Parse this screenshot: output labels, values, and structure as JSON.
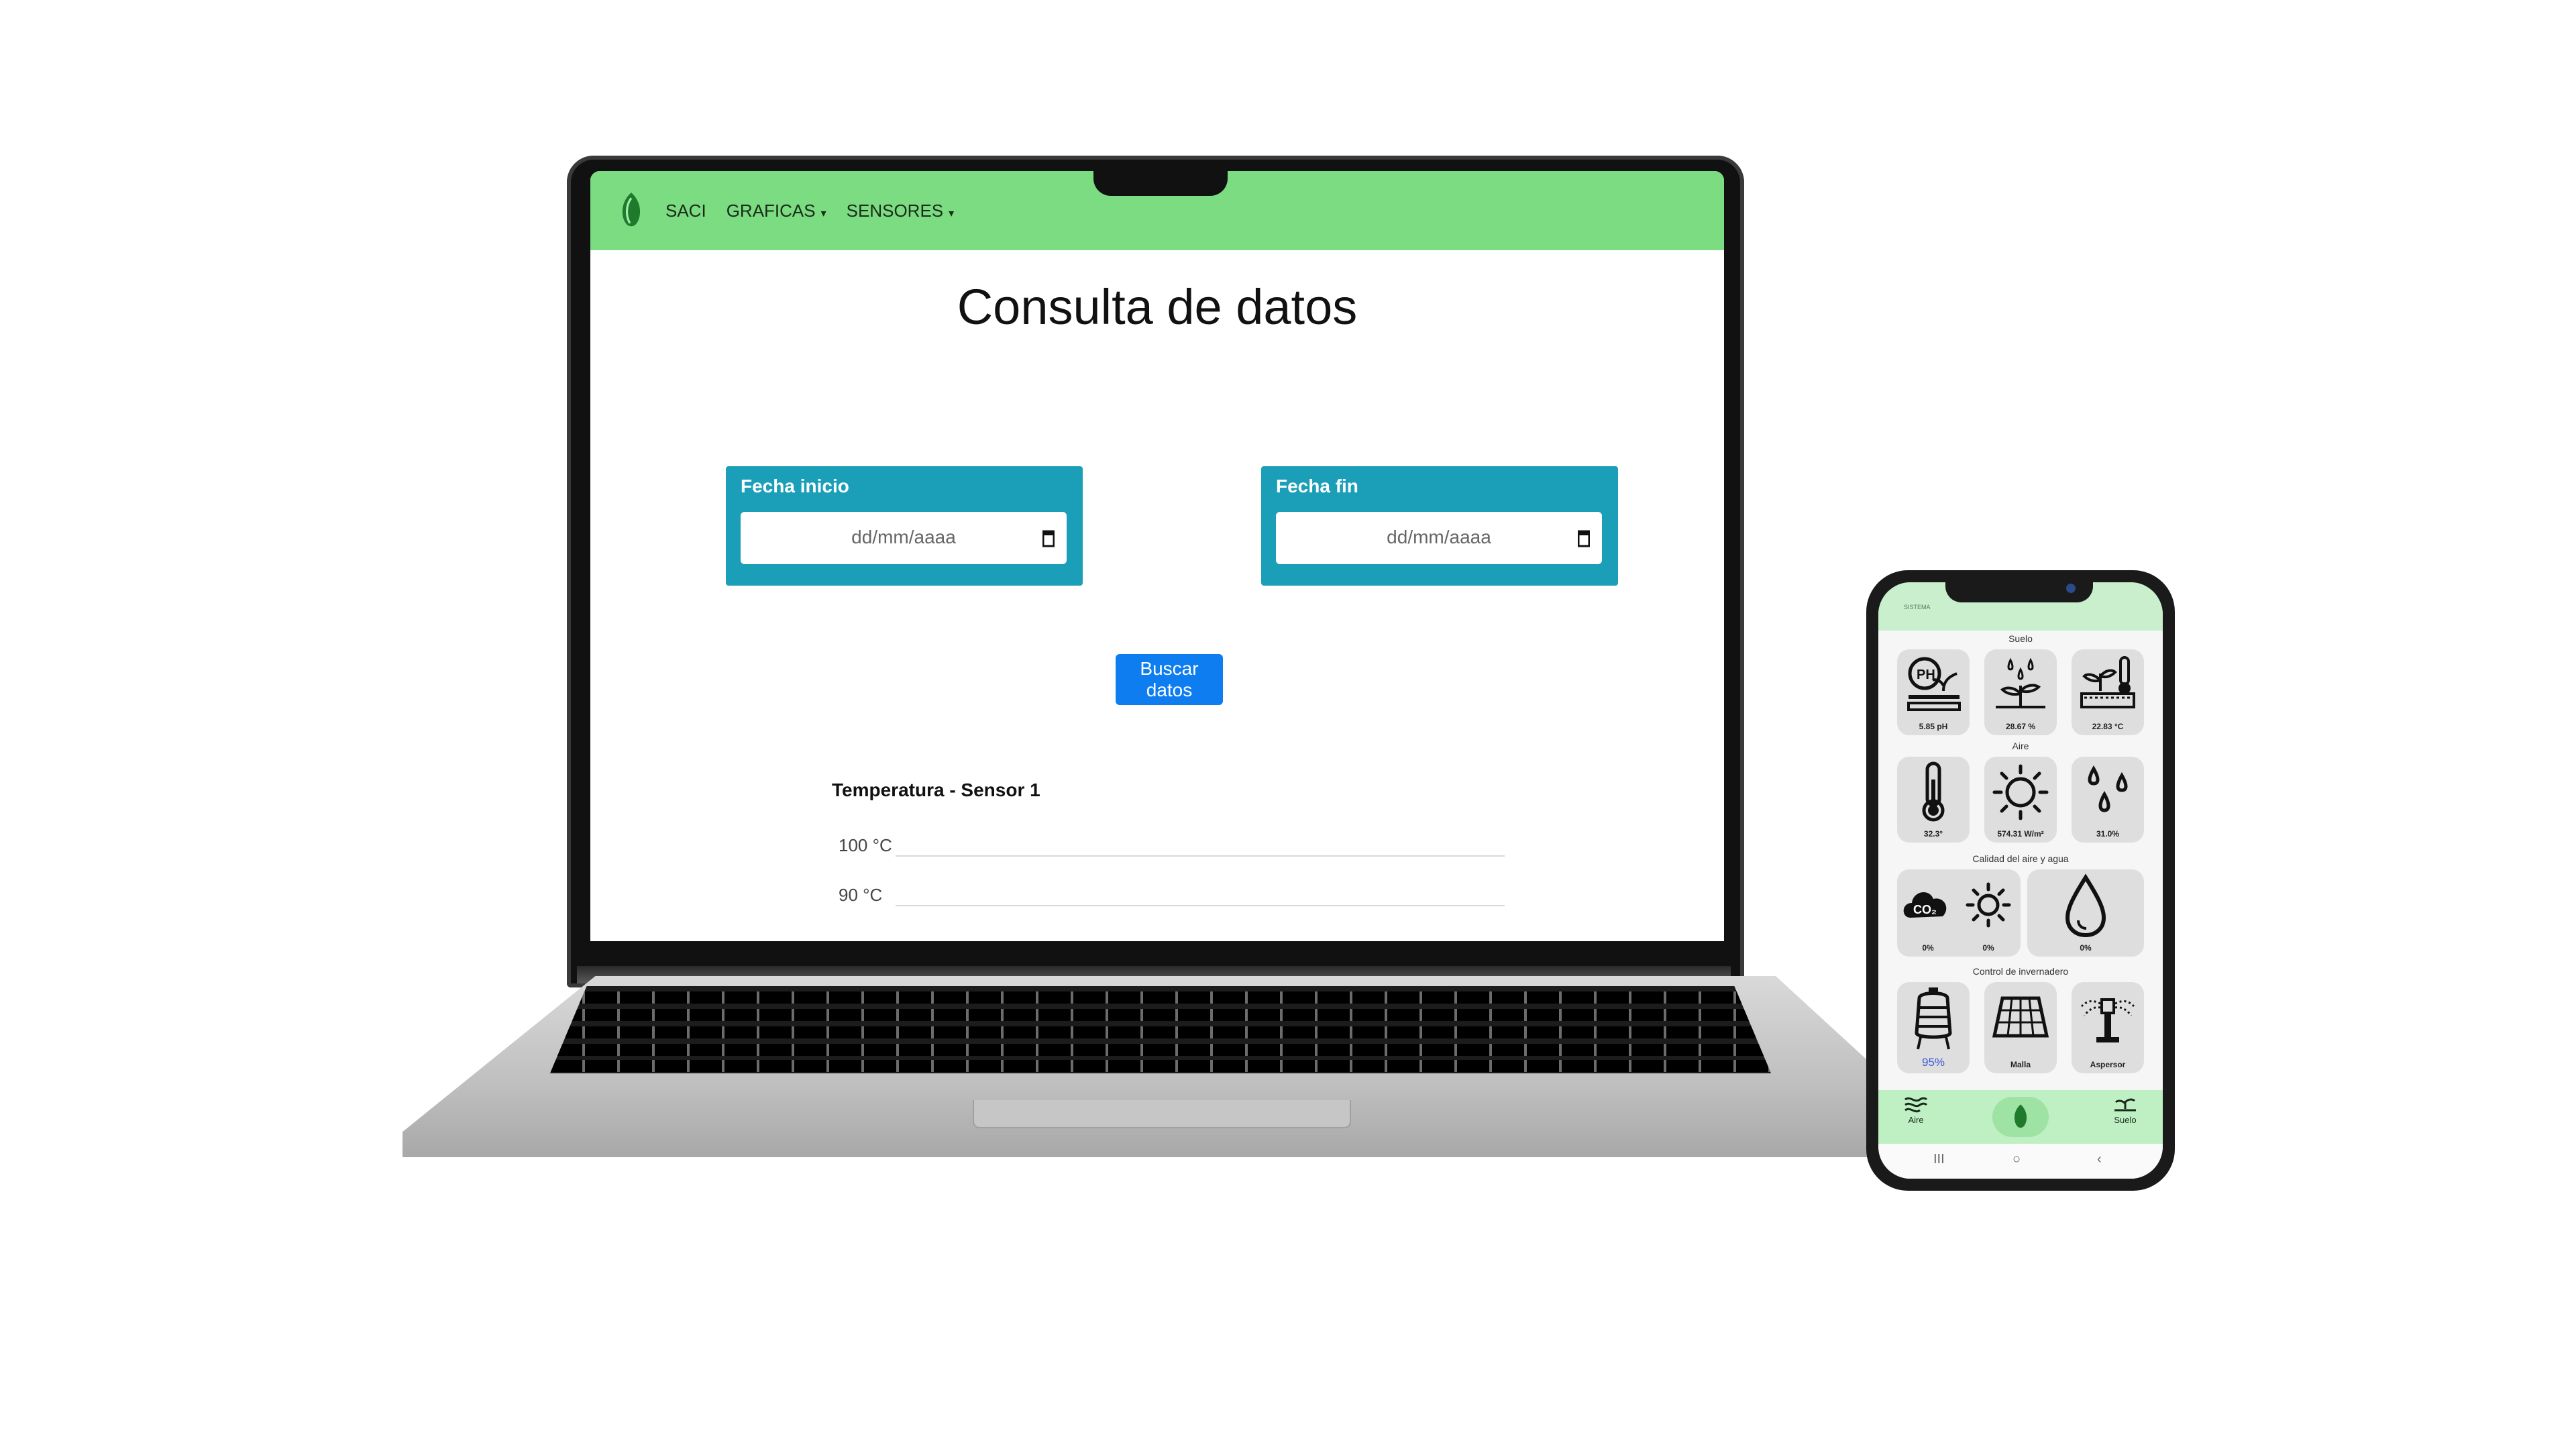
{
  "laptop": {
    "navbar": {
      "brand": "SACI",
      "items": [
        {
          "label": "GRAFICAS"
        },
        {
          "label": "SENSORES"
        }
      ],
      "caret": "▾"
    },
    "page_title": "Consulta de datos",
    "start_date": {
      "label": "Fecha inicio",
      "placeholder": "dd/mm/aaaa"
    },
    "end_date": {
      "label": "Fecha fin",
      "placeholder": "dd/mm/aaaa"
    },
    "search_button": "Buscar datos",
    "chart": {
      "title": "Temperatura - Sensor 1",
      "y_ticks": [
        "100 °C",
        "90 °C"
      ]
    }
  },
  "phone": {
    "header_text": "SISTEMA",
    "sections": {
      "soil": "Suelo",
      "air": "Aire",
      "quality": "Calidad del aire y agua",
      "control": "Control de invernadero"
    },
    "soil_tiles": [
      {
        "icon": "ph-soil-icon",
        "value": "5.85 pH"
      },
      {
        "icon": "soil-moisture-icon",
        "value": "28.67 %"
      },
      {
        "icon": "soil-temperature-icon",
        "value": "22.83 °C"
      }
    ],
    "air_tiles": [
      {
        "icon": "thermometer-icon",
        "value": "32.3°"
      },
      {
        "icon": "sun-icon",
        "value": "574.31 W/m²"
      },
      {
        "icon": "humidity-drops-icon",
        "value": "31.0%"
      }
    ],
    "quality_tiles": [
      {
        "icon": "co2-cloud-icon",
        "value": "0%"
      },
      {
        "icon": "light-sun-icon",
        "value": "0%"
      },
      {
        "icon": "water-drop-icon",
        "value": "0%"
      }
    ],
    "control_tiles": [
      {
        "icon": "water-tank-icon",
        "value": "95%"
      },
      {
        "icon": "mesh-icon",
        "value": "Malla"
      },
      {
        "icon": "sprinkler-icon",
        "value": "Aspersor"
      }
    ],
    "bottom_nav": {
      "air": "Aire",
      "soil": "Suelo"
    },
    "system_nav": {
      "recent": "III",
      "home": "○",
      "back": "‹"
    }
  },
  "colors": {
    "navbar_green": "#7bdc82",
    "card_teal": "#1b9fb9",
    "button_blue": "#0d7df0",
    "phone_header_green": "#c9efcd"
  }
}
